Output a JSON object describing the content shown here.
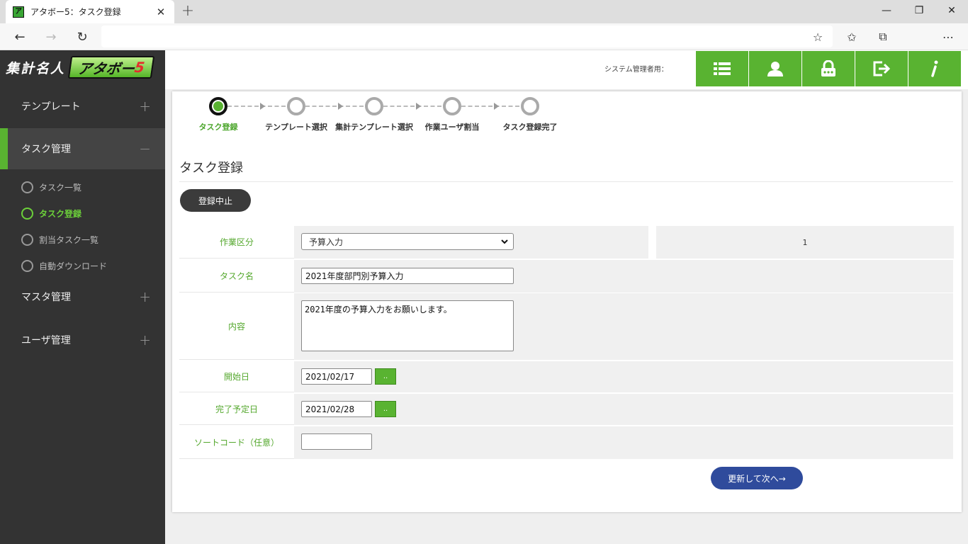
{
  "browser": {
    "tab_title": "アタボー5：タスク登録",
    "favicon_text": "ア",
    "url": ""
  },
  "sidebar": {
    "logo_text": "集計名人",
    "logo_badge": "アタボー",
    "logo_badge_num": "5",
    "menus": [
      {
        "label": "テンプレート",
        "toggle": "+"
      },
      {
        "label": "タスク管理",
        "toggle": "−"
      },
      {
        "label": "マスタ管理",
        "toggle": "+"
      },
      {
        "label": "ユーザ管理",
        "toggle": "+"
      }
    ],
    "task_submenu": [
      {
        "label": "タスク一覧"
      },
      {
        "label": "タスク登録"
      },
      {
        "label": "割当タスク一覧"
      },
      {
        "label": "自動ダウンロード"
      }
    ]
  },
  "header": {
    "admin_label": "システム管理者用："
  },
  "steps": [
    {
      "label": "タスク登録"
    },
    {
      "label": "テンプレート選択"
    },
    {
      "label": "集計テンプレート選択"
    },
    {
      "label": "作業ユーザ割当"
    },
    {
      "label": "タスク登録完了"
    }
  ],
  "page": {
    "title": "タスク登録",
    "cancel_label": "登録中止",
    "next_label": "更新して次へ→"
  },
  "form": {
    "work_type": {
      "label": "作業区分",
      "value": "予算入力",
      "side_value": "1"
    },
    "task_name": {
      "label": "タスク名",
      "value": "2021年度部門別予算入力"
    },
    "content": {
      "label": "内容",
      "value": "2021年度の予算入力をお願いします。"
    },
    "start_date": {
      "label": "開始日",
      "value": "2021/02/17",
      "picker": ".."
    },
    "end_date": {
      "label": "完了予定日",
      "value": "2021/02/28",
      "picker": ".."
    },
    "sort_code": {
      "label": "ソートコード（任意）",
      "value": ""
    }
  },
  "colors": {
    "brand_green": "#59b331",
    "sidebar_bg": "#333333",
    "primary_blue": "#2f4b9c"
  }
}
